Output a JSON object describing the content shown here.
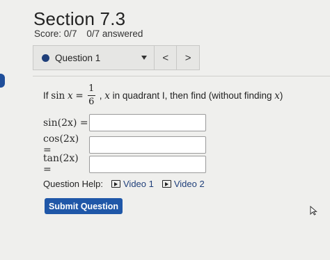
{
  "header": {
    "title": "Section 7.3",
    "score": "Score: 0/7",
    "answered": "0/7 answered"
  },
  "question_nav": {
    "label": "Question 1",
    "prev": "<",
    "next": ">"
  },
  "problem": {
    "prefix": "If",
    "func": "sin",
    "var": "x",
    "equals": "=",
    "numerator": "1",
    "denominator": "6",
    "suffix_var": "x",
    "suffix": "in quadrant I, then find (without finding",
    "suffix_end": ")"
  },
  "answers": [
    {
      "lhs": "sin(2x) =",
      "value": ""
    },
    {
      "lhs": "cos(2x) =",
      "value": ""
    },
    {
      "lhs": "tan(2x) =",
      "value": ""
    }
  ],
  "help": {
    "label": "Question Help:",
    "video1": "Video 1",
    "video2": "Video 2"
  },
  "submit": {
    "label": "Submit Question"
  },
  "colors": {
    "accent": "#1f57a8",
    "dot": "#1f3f7a",
    "background": "#efefed"
  }
}
